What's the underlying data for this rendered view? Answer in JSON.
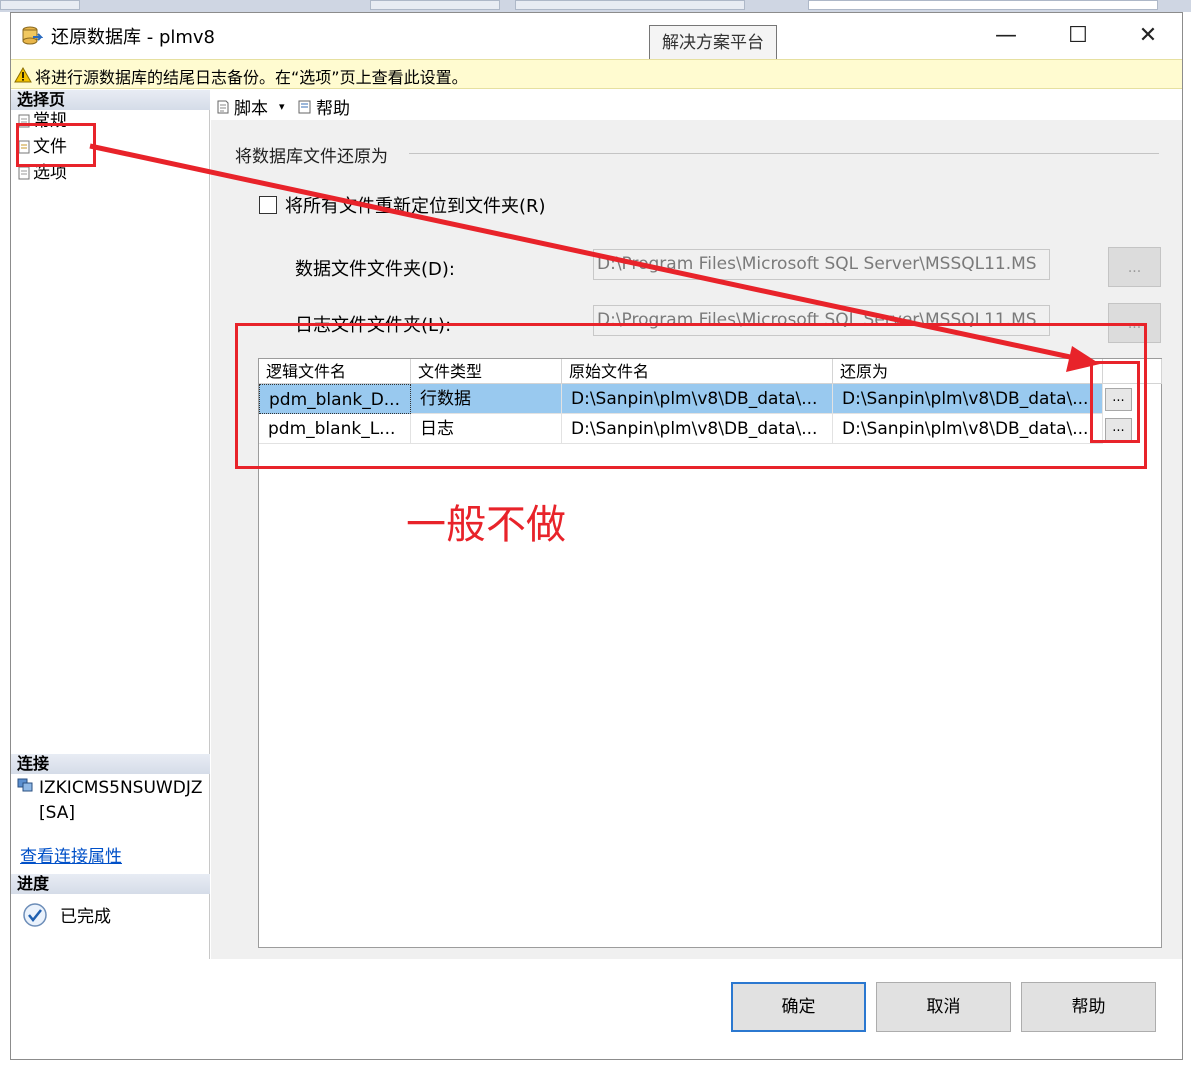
{
  "window": {
    "title": "还原数据库 - plmv8",
    "tooltip": "解决方案平台",
    "minimize_glyph": "—",
    "maximize_glyph": "☐",
    "close_glyph": "✕"
  },
  "warning": {
    "text": "将进行源数据库的结尾日志备份。在“选项”页上查看此设置。"
  },
  "sidebar": {
    "select_page_header": "选择页",
    "items": [
      {
        "label": "常规"
      },
      {
        "label": "文件"
      },
      {
        "label": "选项"
      }
    ],
    "connection_header": "连接",
    "server_name": "IZKICMS5NSUWDJZ [SA]",
    "view_connection_link": "查看连接属性",
    "progress_header": "进度",
    "progress_status": "已完成"
  },
  "toolbar": {
    "script_label": "脚本",
    "script_arrow": "▾",
    "help_label": "帮助"
  },
  "files_page": {
    "group_title": "将数据库文件还原为",
    "relocate_checkbox_label": "将所有文件重新定位到文件夹(R)",
    "relocate_checked": false,
    "data_folder_label": "数据文件文件夹(D):",
    "data_folder_value": "D:\\Program Files\\Microsoft SQL Server\\MSSQL11.MS",
    "log_folder_label": "日志文件文件夹(L):",
    "log_folder_value": "D:\\Program Files\\Microsoft SQL Server\\MSSQL11.MS",
    "browse_label": "...",
    "grid": {
      "columns": [
        "逻辑文件名",
        "文件类型",
        "原始文件名",
        "还原为"
      ],
      "rows": [
        [
          "pdm_blank_D...",
          "行数据",
          "D:\\Sanpin\\plm\\v8\\DB_data\\...",
          "D:\\Sanpin\\plm\\v8\\DB_data\\..."
        ],
        [
          "pdm_blank_L...",
          "日志",
          "D:\\Sanpin\\plm\\v8\\DB_data\\...",
          "D:\\Sanpin\\plm\\v8\\DB_data\\..."
        ]
      ],
      "row_button_label": "..."
    }
  },
  "buttons": {
    "ok": "确定",
    "cancel": "取消",
    "help": "帮助"
  },
  "annotation": {
    "note": "一般不做",
    "color": "#e8232a"
  },
  "colors": {
    "selected_row": "#99c9ef",
    "warning_bg": "#fffbd0",
    "link": "#0050c8"
  }
}
